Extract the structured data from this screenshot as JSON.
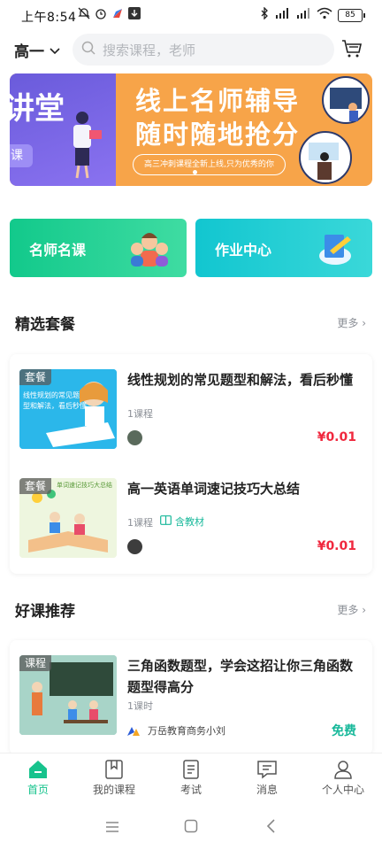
{
  "status": {
    "time": "上午8:54",
    "battery": "85"
  },
  "header": {
    "grade": "高一",
    "search_placeholder": "搜索课程，老师"
  },
  "banner": {
    "left_text": "讲堂",
    "left_tag": "课",
    "headline1": "线上名师辅导",
    "headline2": "随时随地抢分",
    "subline": "高三冲刺课程全新上线,只为优秀的你"
  },
  "quick": [
    {
      "label": "名师名课"
    },
    {
      "label": "作业中心"
    }
  ],
  "featured": {
    "title": "精选套餐",
    "more": "更多",
    "items": [
      {
        "tag": "套餐",
        "title": "线性规划的常见题型和解法，看后秒懂",
        "meta": "1课程",
        "price": "¥0.01",
        "thumb_color": "#26b4e8"
      },
      {
        "tag": "套餐",
        "title": "高一英语单词速记技巧大总结",
        "meta": "1课程",
        "extra": "含教材",
        "price": "¥0.01",
        "thumb_color": "#eef7e0"
      }
    ]
  },
  "recommend": {
    "title": "好课推荐",
    "more": "更多",
    "items": [
      {
        "tag": "课程",
        "title": "三角函数题型，学会这招让你三角函数题型得高分",
        "meta": "1课时",
        "author": "万岳教育商务小刘",
        "price": "免费"
      }
    ]
  },
  "tabs": [
    {
      "label": "首页",
      "icon": "home-icon",
      "active": true
    },
    {
      "label": "我的课程",
      "icon": "book-icon"
    },
    {
      "label": "考试",
      "icon": "exam-icon"
    },
    {
      "label": "消息",
      "icon": "message-icon"
    },
    {
      "label": "个人中心",
      "icon": "user-icon"
    }
  ],
  "colors": {
    "accent": "#17c38d",
    "price": "#f0283e",
    "banner": "#f7a449"
  }
}
